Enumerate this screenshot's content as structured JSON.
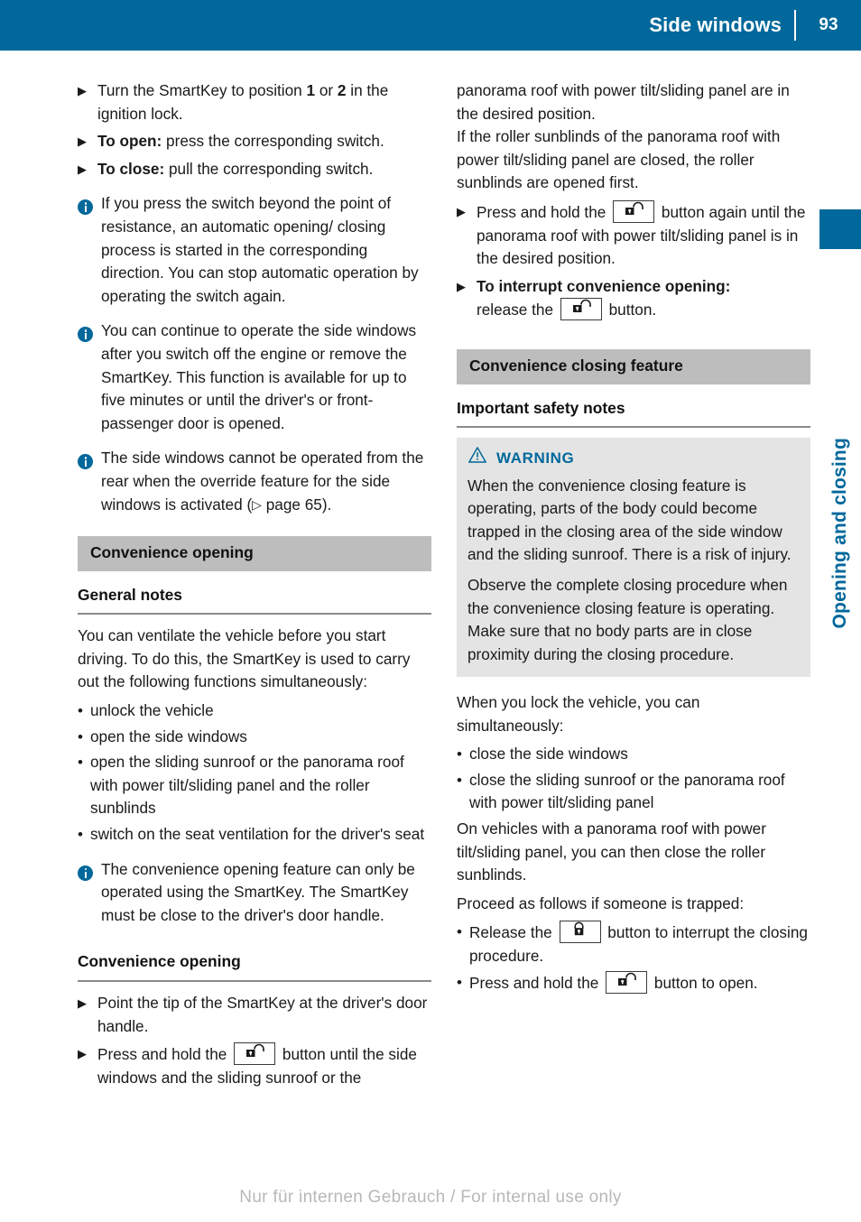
{
  "header": {
    "title": "Side windows",
    "page_number": "93"
  },
  "side_tab": {
    "label": "Opening and closing",
    "color": "#00689b"
  },
  "colors": {
    "header_blue": "#00689b",
    "section_bar_grey": "#bdbdbd",
    "warning_box_grey": "#e4e4e4",
    "warning_blue": "#00689b",
    "rule_grey": "#8a8a8a"
  },
  "icons": {
    "info": "info-circle-icon",
    "warning": "warning-triangle-icon",
    "unlock_button": "unlock-button-icon",
    "lock_button": "lock-button-icon",
    "step_marker": "▶",
    "bullet_marker": "•",
    "xref_marker": "▷"
  },
  "left_column": {
    "steps": [
      {
        "lead": "",
        "text": "Turn the SmartKey to position ",
        "bold_1": "1",
        "mid": " or ",
        "bold_2": "2",
        "tail": " in the ignition lock."
      },
      {
        "lead": "To open:",
        "text": " press the corresponding switch."
      },
      {
        "lead": "To close:",
        "text": " pull the corresponding switch."
      }
    ],
    "notes": [
      "If you press the switch beyond the point of resistance, an automatic opening/ closing process is started in the corresponding direction. You can stop automatic operation by operating the switch again.",
      "You can continue to operate the side windows after you switch off the engine or remove the SmartKey. This function is available for up to five minutes or until the driver's or front-passenger door is opened.",
      {
        "before": "The side windows cannot be operated from the rear when the override feature for the side windows is activated (",
        "xref": " page 65",
        "after": ")."
      }
    ],
    "section_title": "Convenience opening",
    "general_notes_heading": "General notes",
    "general_notes_text": "You can ventilate the vehicle before you start driving. To do this, the SmartKey is used to carry out the following functions simultaneously:",
    "function_bullets": [
      "unlock the vehicle",
      "open the side windows",
      "open the sliding sunroof or the panorama roof with power tilt/sliding panel and the roller sunblinds",
      "switch on the seat ventilation for the driver's seat"
    ],
    "smartkey_note": "The convenience opening feature can only be operated using the SmartKey. The SmartKey must be close to the driver's door handle.",
    "convenience_opening_heading": "Convenience opening",
    "procedure_steps": [
      {
        "text": "Point the tip of the SmartKey at the driver's door handle."
      },
      {
        "before": "Press and hold the ",
        "icon": "unlock_button",
        "after": " button until the side windows and the sliding sunroof or the"
      }
    ]
  },
  "right_column": {
    "continuation_1": "panorama roof with power tilt/sliding panel are in the desired position.",
    "continuation_2": "If the roller sunblinds of the panorama roof with power tilt/sliding panel are closed, the roller sunblinds are opened first.",
    "steps": [
      {
        "before": "Press and hold the ",
        "icon": "unlock_button",
        "after": " button again until the panorama roof with power tilt/sliding panel is in the desired position."
      },
      {
        "lead": "To interrupt convenience opening:",
        "before": "release the ",
        "icon": "unlock_button",
        "after": " button."
      }
    ],
    "section_title": "Convenience closing feature",
    "safety_heading": "Important safety notes",
    "warning": {
      "title": "WARNING",
      "paragraphs": [
        "When the convenience closing feature is operating, parts of the body could become trapped in the closing area of the side window and the sliding sunroof. There is a risk of injury.",
        "Observe the complete closing procedure when the convenience closing feature is operating. Make sure that no body parts are in close proximity during the closing procedure."
      ]
    },
    "lock_intro": "When you lock the vehicle, you can simultaneously:",
    "lock_bullets": [
      "close the side windows",
      "close the sliding sunroof or the panorama roof with power tilt/sliding panel"
    ],
    "panorama_note": "On vehicles with a panorama roof with power tilt/sliding panel, you can then close the roller sunblinds.",
    "trapped_intro": "Proceed as follows if someone is trapped:",
    "trapped_bullets": [
      {
        "before": "Release the ",
        "icon": "lock_button",
        "after": " button to interrupt the closing procedure."
      },
      {
        "before": "Press and hold the ",
        "icon": "unlock_button",
        "after": " button to open."
      }
    ]
  },
  "footer": {
    "watermark": "Nur für internen Gebrauch / For internal use only"
  }
}
